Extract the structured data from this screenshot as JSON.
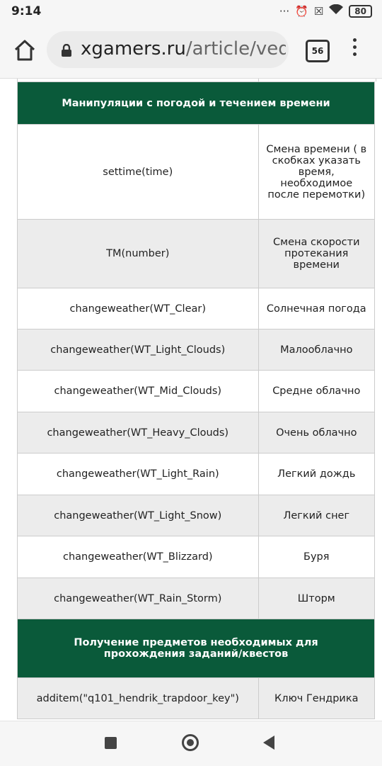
{
  "status_bar": {
    "time": "9:14",
    "battery": "80"
  },
  "browser": {
    "url_domain": "xgamers.ru",
    "url_path": "/article/ved",
    "tab_count": "56"
  },
  "table": {
    "sections": [
      {
        "header": "Манипуляции с погодой и течением времени",
        "rows": [
          {
            "cmd": "settime(time)",
            "desc": "Смена времени ( в скобках указать время, необходимое после перемотки)"
          },
          {
            "cmd": "TM(number)",
            "desc": "Смена скорости протекания времени"
          },
          {
            "cmd": "changeweather(WT_Clear)",
            "desc": "Солнечная погода"
          },
          {
            "cmd": "changeweather(WT_Light_Clouds)",
            "desc": "Малооблачно"
          },
          {
            "cmd": "changeweather(WT_Mid_Clouds)",
            "desc": "Средне облачно"
          },
          {
            "cmd": "changeweather(WT_Heavy_Clouds)",
            "desc": "Очень облачно"
          },
          {
            "cmd": "changeweather(WT_Light_Rain)",
            "desc": "Легкий дождь"
          },
          {
            "cmd": "changeweather(WT_Light_Snow)",
            "desc": "Легкий снег"
          },
          {
            "cmd": "changeweather(WT_Blizzard)",
            "desc": "Буря"
          },
          {
            "cmd": "changeweather(WT_Rain_Storm)",
            "desc": "Шторм"
          }
        ]
      },
      {
        "header": "Получение предметов необходимых для прохождения заданий/квестов",
        "rows": [
          {
            "cmd": "additem(\"q101_hendrik_trapdoor_key\")",
            "desc": "Ключ Гендрика"
          }
        ]
      }
    ]
  },
  "colors": {
    "header_bg": "#0a5a3a",
    "alt_row_bg": "#ececec"
  }
}
